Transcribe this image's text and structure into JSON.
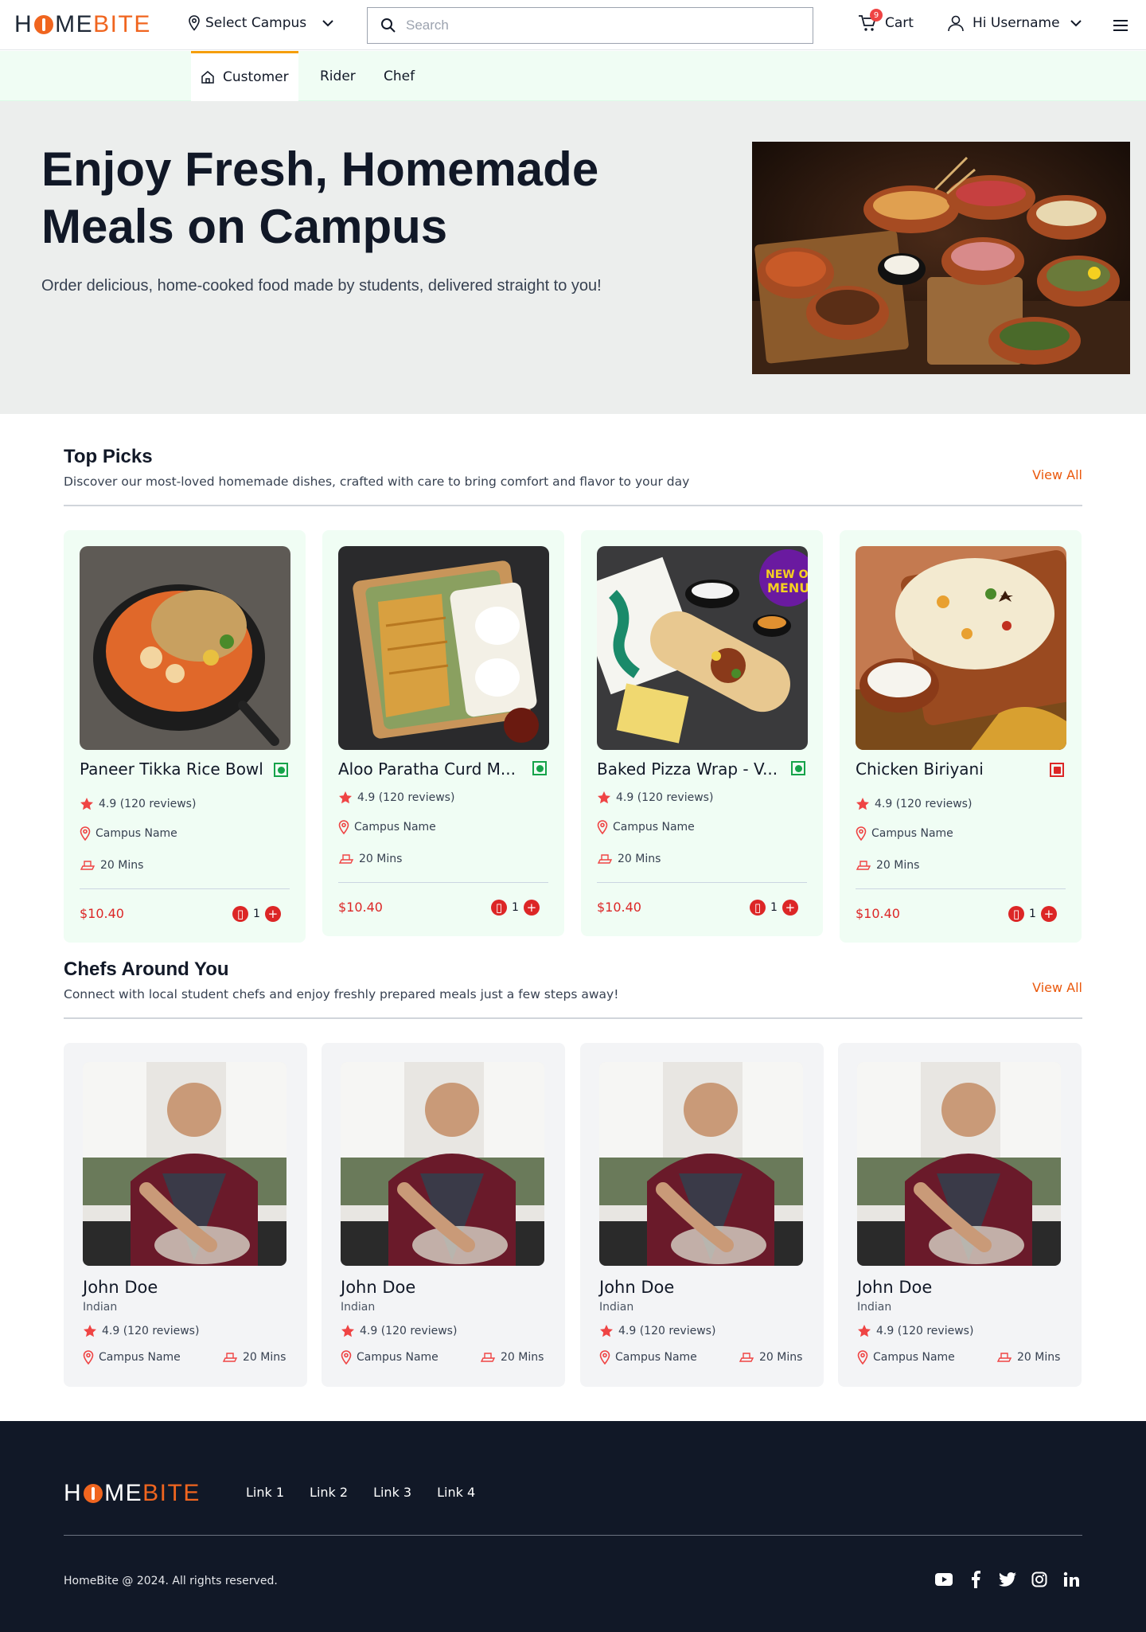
{
  "header": {
    "logo_home": "H",
    "logo_rest": "ME",
    "logo_bite": "BITE",
    "campus_label": "Select Campus",
    "search_placeholder": "Search",
    "cart_label": "Cart",
    "cart_count": "9",
    "user_label": "Hi Username"
  },
  "tabs": [
    {
      "label": "Customer",
      "active": true
    },
    {
      "label": "Rider",
      "active": false
    },
    {
      "label": "Chef",
      "active": false
    }
  ],
  "hero": {
    "title": "Enjoy Fresh, Homemade Meals on Campus",
    "subtitle": "Order delicious, home-cooked food made by students, delivered straight to you!"
  },
  "top_picks": {
    "title": "Top Picks",
    "subtitle": "Discover our most-loved homemade dishes, crafted with care to bring comfort and flavor to your day",
    "view_all": "View All",
    "items": [
      {
        "name": "Paneer Tikka Rice Bowl",
        "veg": true,
        "rating": "4.9 (120 reviews)",
        "campus": "Campus Name",
        "time": "20 Mins",
        "price": "$10.40",
        "qty": "1"
      },
      {
        "name": "Aloo Paratha Curd M...",
        "veg": true,
        "rating": "4.9 (120 reviews)",
        "campus": "Campus Name",
        "time": "20 Mins",
        "price": "$10.40",
        "qty": "1"
      },
      {
        "name": "Baked Pizza Wrap - V...",
        "veg": true,
        "rating": "4.9 (120 reviews)",
        "campus": "Campus Name",
        "time": "20 Mins",
        "price": "$10.40",
        "qty": "1"
      },
      {
        "name": "Chicken Biriyani",
        "veg": false,
        "rating": "4.9 (120 reviews)",
        "campus": "Campus Name",
        "time": "20 Mins",
        "price": "$10.40",
        "qty": "1"
      }
    ]
  },
  "chefs": {
    "title": "Chefs Around You",
    "subtitle": "Connect with local student chefs and enjoy freshly prepared meals just a few steps away!",
    "view_all": "View All",
    "items": [
      {
        "name": "John Doe",
        "cuisine": "Indian",
        "rating": "4.9 (120 reviews)",
        "campus": "Campus Name",
        "time": "20 Mins"
      },
      {
        "name": "John Doe",
        "cuisine": "Indian",
        "rating": "4.9 (120 reviews)",
        "campus": "Campus Name",
        "time": "20 Mins"
      },
      {
        "name": "John Doe",
        "cuisine": "Indian",
        "rating": "4.9 (120 reviews)",
        "campus": "Campus Name",
        "time": "20 Mins"
      },
      {
        "name": "John Doe",
        "cuisine": "Indian",
        "rating": "4.9 (120 reviews)",
        "campus": "Campus Name",
        "time": "20 Mins"
      }
    ]
  },
  "footer": {
    "links": [
      "Link 1",
      "Link 2",
      "Link 3",
      "Link 4"
    ],
    "copyright": "HomeBite @ 2024. All rights reserved.",
    "socials": [
      "youtube-icon",
      "facebook-icon",
      "twitter-icon",
      "instagram-icon",
      "linkedin-icon"
    ]
  },
  "colors": {
    "accent": "#f0651f",
    "price": "#dc2626",
    "card_bg": "#f0fdf4",
    "footer_bg": "#111827"
  }
}
